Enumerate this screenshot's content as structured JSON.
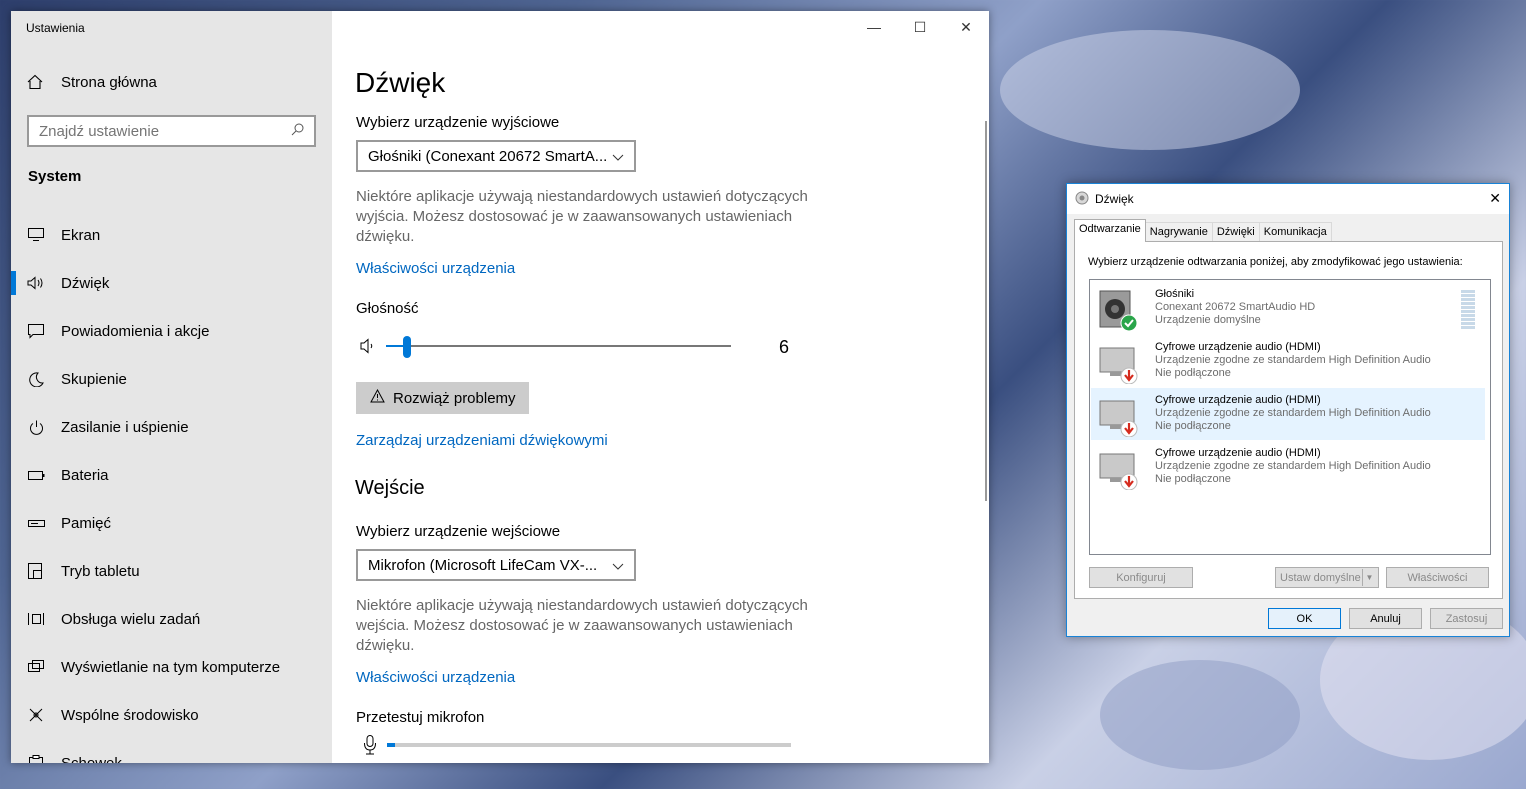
{
  "settings": {
    "title": "Ustawienia",
    "home": "Strona główna",
    "search_placeholder": "Znajdź ustawienie",
    "section": "System",
    "nav": [
      {
        "label": "Ekran",
        "icon": "monitor-icon"
      },
      {
        "label": "Dźwięk",
        "icon": "speaker-icon",
        "active": true
      },
      {
        "label": "Powiadomienia i akcje",
        "icon": "notification-icon"
      },
      {
        "label": "Skupienie",
        "icon": "moon-icon"
      },
      {
        "label": "Zasilanie i uśpienie",
        "icon": "power-icon"
      },
      {
        "label": "Bateria",
        "icon": "battery-icon"
      },
      {
        "label": "Pamięć",
        "icon": "storage-icon"
      },
      {
        "label": "Tryb tabletu",
        "icon": "tablet-icon"
      },
      {
        "label": "Obsługa wielu zadań",
        "icon": "multitask-icon"
      },
      {
        "label": "Wyświetlanie na tym komputerze",
        "icon": "project-icon"
      },
      {
        "label": "Wspólne środowisko",
        "icon": "shared-icon"
      },
      {
        "label": "Schowek",
        "icon": "clipboard-icon"
      }
    ]
  },
  "sound": {
    "title": "Dźwięk",
    "output_label": "Wybierz urządzenie wyjściowe",
    "output_device": "Głośniki (Conexant 20672 SmartA...",
    "output_desc": "Niektóre aplikacje używają niestandardowych ustawień dotyczących wyjścia. Możesz dostosować je w zaawansowanych ustawieniach dźwięku.",
    "output_props_link": "Właściwości urządzenia",
    "volume_label": "Głośność",
    "volume_value": "6",
    "volume_fraction": 0.06,
    "troubleshoot": "Rozwiąż problemy",
    "manage_link": "Zarządzaj urządzeniami dźwiękowymi",
    "input_heading": "Wejście",
    "input_label": "Wybierz urządzenie wejściowe",
    "input_device": "Mikrofon (Microsoft LifeCam VX-...",
    "input_desc": "Niektóre aplikacje używają niestandardowych ustawień dotyczących wejścia. Możesz dostosować je w zaawansowanych ustawieniach dźwięku.",
    "input_props_link": "Właściwości urządzenia",
    "mic_test_label": "Przetestuj mikrofon",
    "mic_level_fraction": 0.02
  },
  "dialog": {
    "title": "Dźwięk",
    "tabs": [
      "Odtwarzanie",
      "Nagrywanie",
      "Dźwięki",
      "Komunikacja"
    ],
    "instruction": "Wybierz urządzenie odtwarzania poniżej, aby zmodyfikować jego ustawienia:",
    "devices": [
      {
        "name": "Głośniki",
        "line2": "Conexant 20672 SmartAudio HD",
        "line3": "Urządzenie domyślne"
      },
      {
        "name": "Cyfrowe urządzenie audio (HDMI)",
        "line2": "Urządzenie zgodne ze standardem High Definition Audio",
        "line3": "Nie podłączone"
      },
      {
        "name": "Cyfrowe urządzenie audio (HDMI)",
        "line2": "Urządzenie zgodne ze standardem High Definition Audio",
        "line3": "Nie podłączone"
      },
      {
        "name": "Cyfrowe urządzenie audio (HDMI)",
        "line2": "Urządzenie zgodne ze standardem High Definition Audio",
        "line3": "Nie podłączone"
      }
    ],
    "buttons": {
      "configure": "Konfiguruj",
      "set_default": "Ustaw domyślne",
      "properties": "Właściwości",
      "ok": "OK",
      "cancel": "Anuluj",
      "apply": "Zastosuj"
    }
  }
}
